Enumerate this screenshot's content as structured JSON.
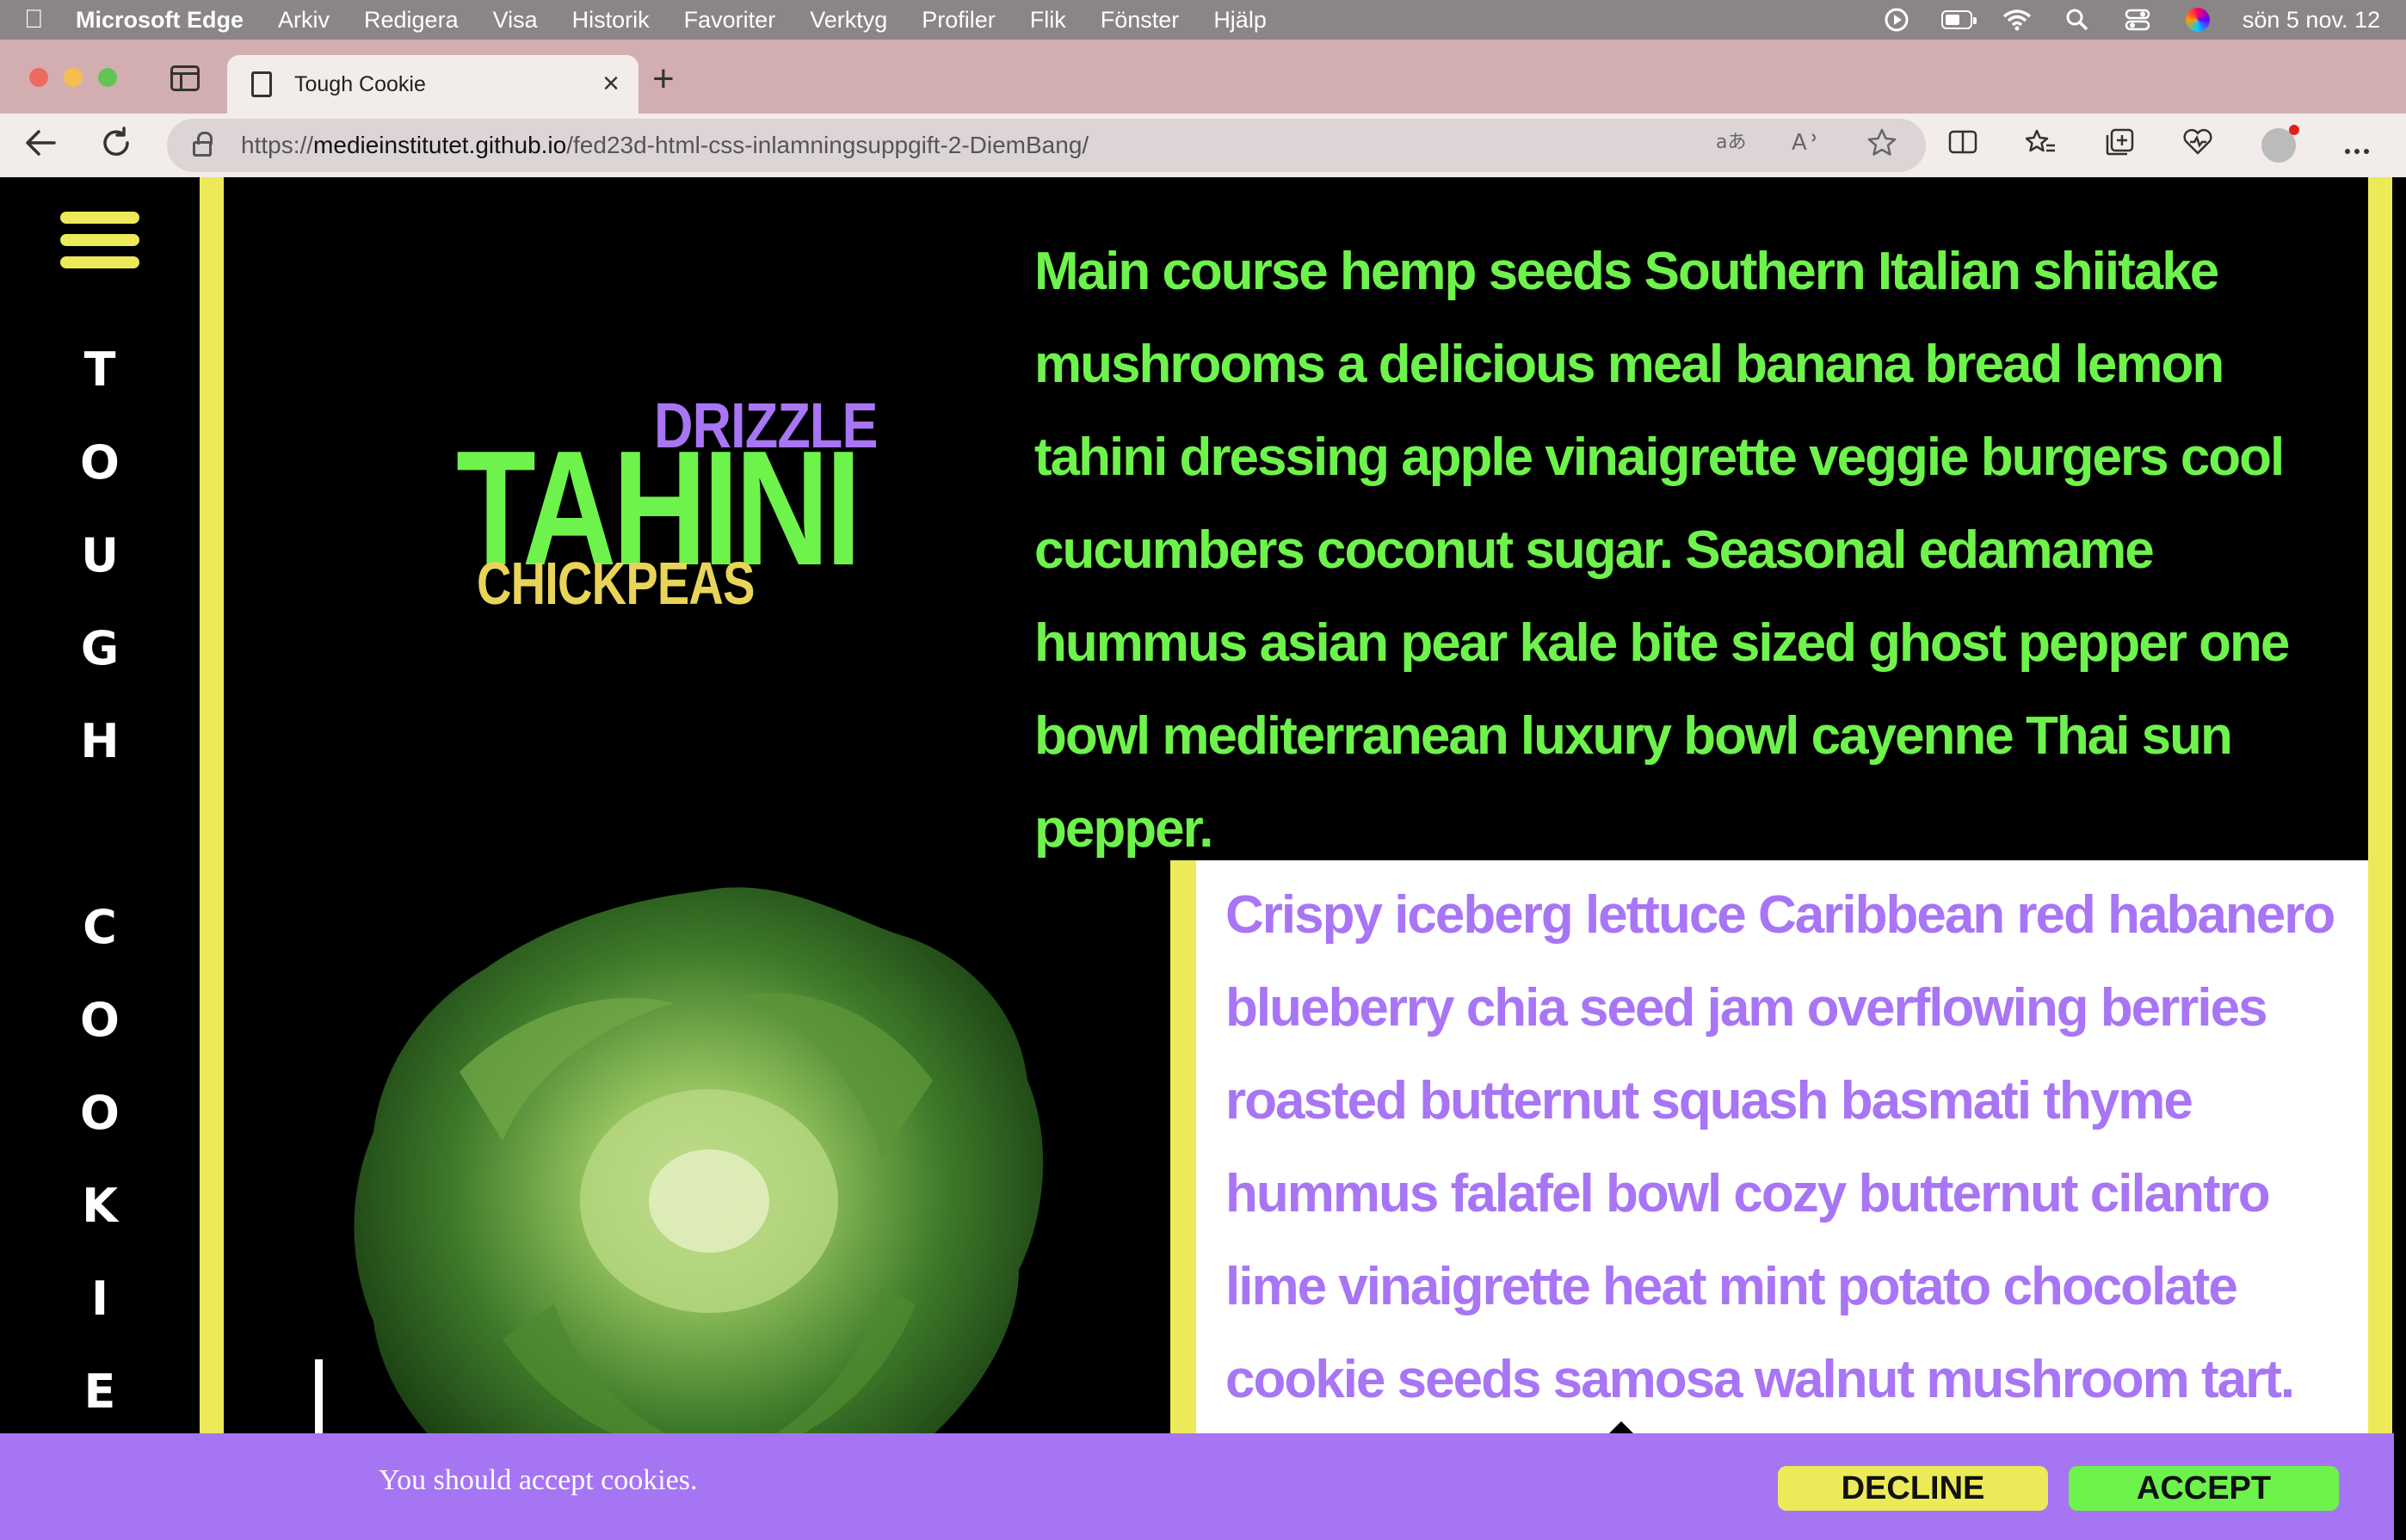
{
  "menubar": {
    "app_name": "Microsoft Edge",
    "items": [
      "Arkiv",
      "Redigera",
      "Visa",
      "Historik",
      "Favoriter",
      "Verktyg",
      "Profiler",
      "Flik",
      "Fönster",
      "Hjälp"
    ],
    "clock": "sön 5 nov. 12"
  },
  "browser": {
    "tab_title": "Tough Cookie",
    "url_scheme": "https://",
    "url_host": "medieinstitutet.github.io",
    "url_path": "/fed23d-html-css-inlamningsuppgift-2-DiemBang/"
  },
  "sidebar": {
    "title_letters": [
      "T",
      "O",
      "U",
      "G",
      "H",
      " ",
      "C",
      "O",
      "O",
      "K",
      "I",
      "E"
    ]
  },
  "hero": {
    "word_top": "DRIZZLE",
    "word_main": "TAHINI",
    "word_bottom": "CHICKPEAS"
  },
  "content": {
    "green_paragraph": "Main course hemp seeds Southern Italian shiitake mushrooms a delicious meal banana bread lemon tahini dressing apple vinaigrette veggie burgers cool cucumbers coconut sugar. Seasonal edamame hummus asian pear kale bite sized ghost pepper one bowl mediterranean luxury bowl cayenne Thai sun pepper.",
    "purple_paragraph": "Crispy iceberg lettuce Caribbean red habanero blueberry chia seed jam overflowing berries roasted butternut squash basmati thyme hummus falafel bowl cozy butternut cilantro lime vinaigrette heat mint potato chocolate cookie seeds samosa walnut mushroom tart."
  },
  "cookie": {
    "message": "You should accept cookies.",
    "decline_label": "DECLINE",
    "accept_label": "ACCEPT"
  },
  "colors": {
    "accent_yellow": "#ecea58",
    "accent_green": "#6ef24c",
    "accent_purple": "#a875f5",
    "banner_purple": "#a675f4"
  }
}
